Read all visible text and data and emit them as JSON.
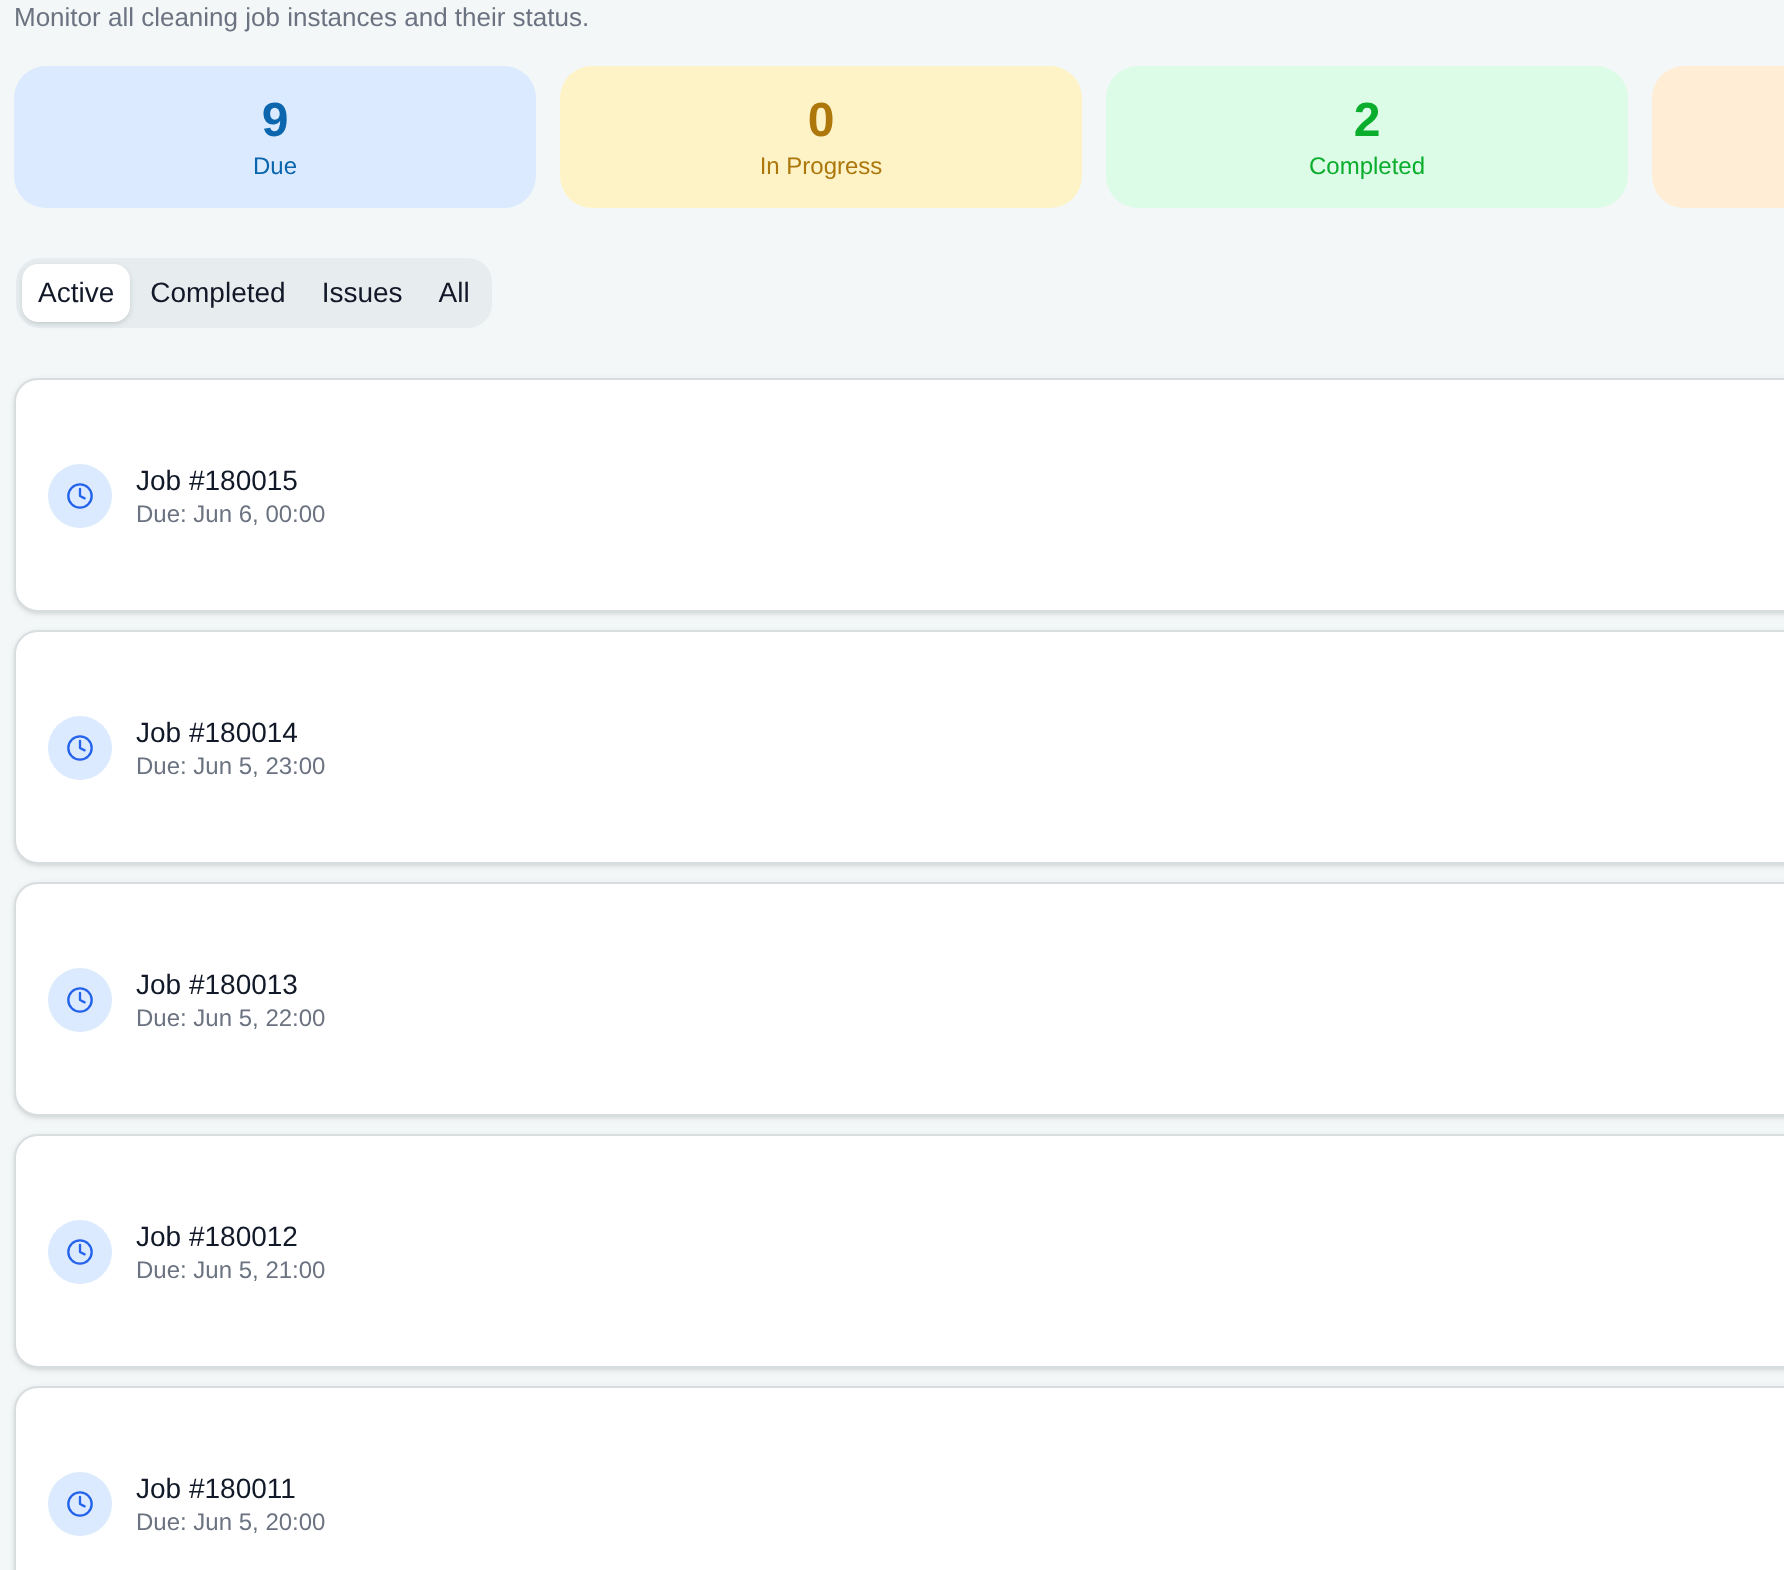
{
  "subtitle": "Monitor all cleaning job instances and their status.",
  "stats": [
    {
      "value": "9",
      "label": "Due",
      "color": "#dbeafe"
    },
    {
      "value": "0",
      "label": "In Progress",
      "color": "#fef3c7"
    },
    {
      "value": "2",
      "label": "Completed",
      "color": "#dcfce7"
    },
    {
      "color": "#ffedd5"
    }
  ],
  "tabs": [
    {
      "label": "Active",
      "selected": true
    },
    {
      "label": "Completed",
      "selected": false
    },
    {
      "label": "Issues",
      "selected": false
    },
    {
      "label": "All",
      "selected": false
    }
  ],
  "jobs": [
    {
      "title": "Job #180015",
      "due": "Due: Jun 6, 00:00"
    },
    {
      "title": "Job #180014",
      "due": "Due: Jun 5, 23:00"
    },
    {
      "title": "Job #180013",
      "due": "Due: Jun 5, 22:00"
    },
    {
      "title": "Job #180012",
      "due": "Due: Jun 5, 21:00"
    },
    {
      "title": "Job #180011",
      "due": "Due: Jun 5, 20:00"
    }
  ]
}
